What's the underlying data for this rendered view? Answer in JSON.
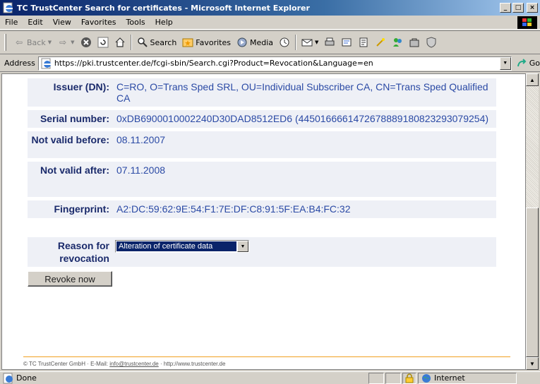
{
  "window": {
    "title": "TC TrustCenter Search for certificates - Microsoft Internet Explorer",
    "minimize": "_",
    "maximize": "□",
    "close": "×"
  },
  "menu": [
    "File",
    "Edit",
    "View",
    "Favorites",
    "Tools",
    "Help"
  ],
  "toolbar": {
    "back": "Back",
    "search": "Search",
    "favorites": "Favorites",
    "media": "Media"
  },
  "address": {
    "label": "Address",
    "url": "https://pki.trustcenter.de/fcgi-sbin/Search.cgi?Product=Revocation&Language=en",
    "go": "Go"
  },
  "certificate": {
    "fields": [
      {
        "label": "Issuer (DN):",
        "value": "C=RO, O=Trans Sped SRL, OU=Individual Subscriber CA, CN=Trans Sped Qualified CA"
      },
      {
        "label": "Serial number:",
        "value": "0xDB6900010002240D30DAD8512ED6 (4450166661472678889180823293079254)"
      },
      {
        "label": "Not valid before:",
        "value": "08.11.2007"
      },
      {
        "label": "Not valid after:",
        "value": "07.11.2008"
      },
      {
        "label": "Fingerprint:",
        "value": "A2:DC:59:62:9E:54:F1:7E:DF:C8:91:5F:EA:B4:FC:32"
      }
    ]
  },
  "revocation": {
    "label": "Reason for revocation",
    "selected": "Alteration of certificate data",
    "button": "Revoke now"
  },
  "footer": {
    "company": "© TC TrustCenter GmbH · E-Mail: ",
    "email": "info@trustcenter.de",
    "separator": " · ",
    "website": "http://www.trustcenter.de"
  },
  "status": {
    "text": "Done",
    "zone": "Internet"
  }
}
